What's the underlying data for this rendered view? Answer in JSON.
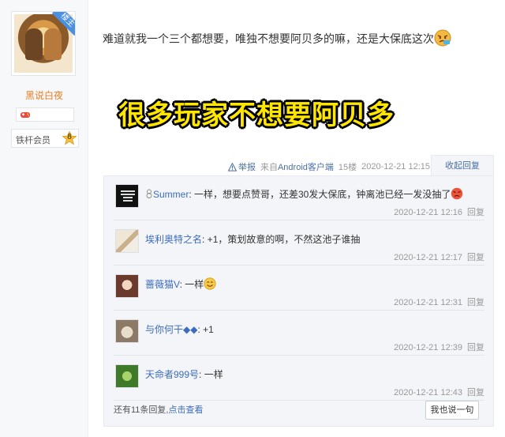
{
  "author": {
    "owner_badge": "楼主",
    "username": "黑说白夜",
    "rank_label": "铁杆会员",
    "rank_level": "8"
  },
  "post": {
    "text": "难道就我一个三个都想要，唯独不想要阿贝多的嘛，还是大保底这次",
    "banner": "很多玩家不想要阿贝多"
  },
  "meta": {
    "report": "举报",
    "from_prefix": "来自",
    "device": "Android客户端",
    "floor": "15楼",
    "time": "2020-12-21 12:15",
    "collapse": "收起回复"
  },
  "replies": [
    {
      "name": "Summer",
      "text": ": 一样，想要点赞哥，还差30发大保底，钟离池已经一发没抽了",
      "time": "2020-12-21 12:16",
      "reply": "回复"
    },
    {
      "name": "埃利奥特之名",
      "text": ": +1，策划故意的啊，不然这池子谁抽",
      "time": "2020-12-21 12:17",
      "reply": "回复"
    },
    {
      "name": "蔷薇猫V",
      "text": ": 一样",
      "time": "2020-12-21 12:31",
      "reply": "回复"
    },
    {
      "name": "与你何干◆◆",
      "text": ": +1",
      "time": "2020-12-21 12:39",
      "reply": "回复"
    },
    {
      "name": "天命者999号",
      "text": ": 一样",
      "time": "2020-12-21 12:43",
      "reply": "回复"
    }
  ],
  "footer": {
    "more_prefix": "还有11条回复,",
    "more_link": "点击查看",
    "say_button": "我也说一句"
  },
  "colors": {
    "link": "#3d6bbf",
    "username": "#e67e22",
    "banner": "#ffe600"
  }
}
